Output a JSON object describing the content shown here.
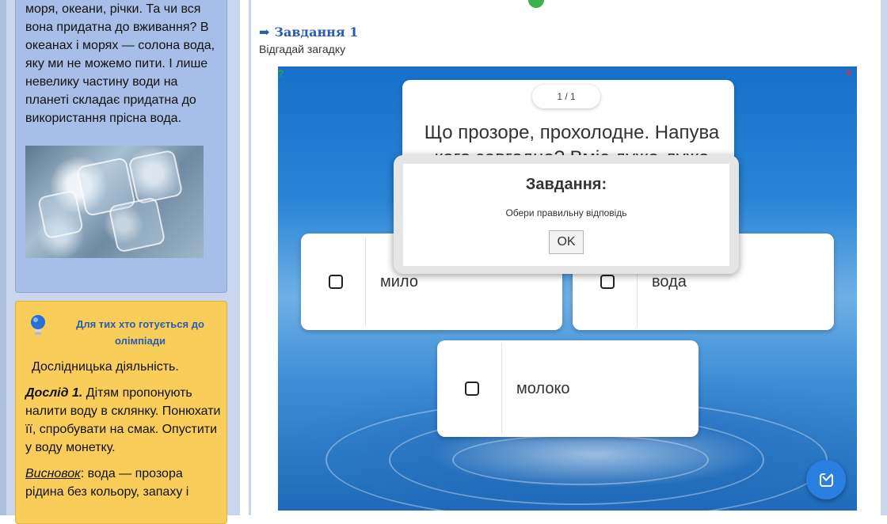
{
  "left_panel": {
    "intro_text": "моря, океани, річки. Та чи вся вона придатна до вживання? В океанах і морях — солона вода, яку ми не можемо пити. І лише невелику частину води на планеті складає придатна до використання прісна вода."
  },
  "olympiad": {
    "title": "Для тих хто готується до олімпіади",
    "subtitle": "Дослідницька діяльність.",
    "experiment_label": "Дослід 1.",
    "experiment_text": " Дітям пропонують налити воду в склянку. Понюхати її, спробувати на смак. Опустити у воду монетку.",
    "conclusion_label": "Висновок",
    "conclusion_text": ": вода — прозора рідина без кольору, запаху і"
  },
  "task": {
    "title": "Завдання 1",
    "subtitle": "Відгадай загадку"
  },
  "quiz": {
    "counter": "1 / 1",
    "question": "Що прозоре, прохолодне. Напува кого завгодно? Вміє дуже-дуже",
    "answers": [
      "мило",
      "вода",
      "молоко"
    ]
  },
  "modal": {
    "title": "Завдання:",
    "message": "Обери правильну відповідь",
    "ok_label": "OK"
  },
  "colors": {
    "accent": "#2a5db0",
    "check_button": "#2a7fe0"
  }
}
